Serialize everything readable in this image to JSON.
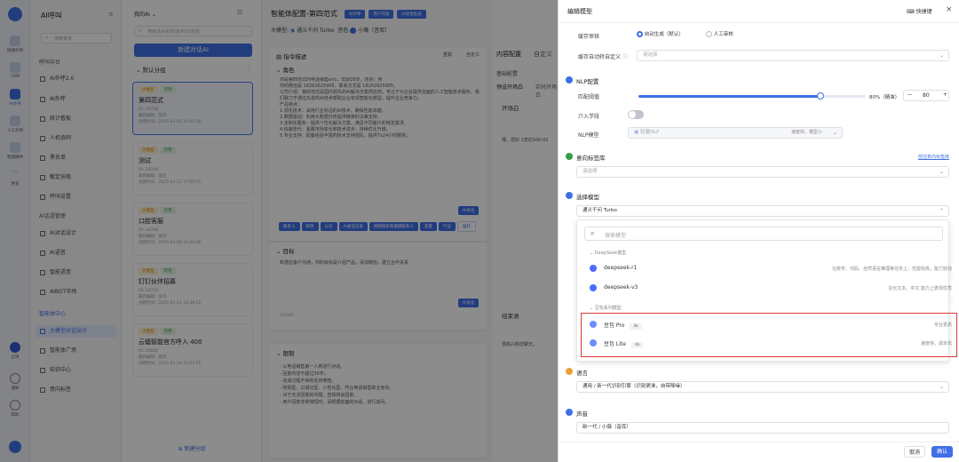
{
  "rail": {
    "items": [
      {
        "label": "快捷外呼"
      },
      {
        "label": "CRM"
      },
      {
        "label": "AI外呼"
      },
      {
        "label": "人工外呼"
      },
      {
        "label": "智能硬件"
      },
      {
        "label": "更多"
      }
    ],
    "bottom": [
      {
        "label": "企呼"
      },
      {
        "label": "通知"
      },
      {
        "label": "帮助"
      }
    ]
  },
  "menu": {
    "title": "AI呼叫",
    "search_placeholder": "搜索菜单",
    "sec1": "呼叫中台",
    "items1": [
      "AI外呼2.0",
      "AI外呼",
      "统计看板",
      "人机协同",
      "黑名单",
      "敏定扶稳",
      "呼叫设置"
    ],
    "sec2": "AI话语管理",
    "items2": [
      "AI对话设计",
      "AI语音",
      "智能语音",
      "AIBOT市场"
    ],
    "sec3": "智能体中心",
    "items3": [
      "大模型对话设计",
      "智能体广场",
      "知识中心",
      "意向标签"
    ]
  },
  "list": {
    "filter": "我的AI",
    "search_placeholder": "搜索话术名称/话术ID/意图",
    "new_button": "新建对话AI",
    "group": "默认分组",
    "add_group": "新建分组",
    "cards": [
      {
        "tag1": "大模型",
        "tag2": "可用",
        "name": "第四范式",
        "id": "ID: 25708",
        "editor": "最新编辑：第四",
        "time": "创建时间：2025-03-05 10:05:50"
      },
      {
        "tag1": "大模型",
        "tag2": "可用",
        "name": "测试",
        "id": "ID: 25509",
        "editor": "最新编辑：留见",
        "time": "创建时间：2025-02-22 17:00:15"
      },
      {
        "tag1": "大模型",
        "tag2": "可用",
        "name": "口腔客服",
        "id": "ID: 24748",
        "editor": "最新编辑：留见",
        "time": "创建时间：2025-02-06 16:20:56"
      },
      {
        "tag1": "大模型",
        "tag2": "可用",
        "name": "钉钉伙伴招募",
        "id": "ID: 24719",
        "editor": "最新编辑：留见",
        "time": "创建时间：2025-01-21 14:34:52"
      },
      {
        "tag1": "大模型",
        "tag2": "可用",
        "name": "云蝠智能官方呼入 400",
        "id": "ID: 24662",
        "editor": "最新编辑：留见",
        "time": "创建时间：2025-01-10 15:47:05"
      }
    ]
  },
  "editor": {
    "title": "智能体配置-第四范式",
    "tags": [
      "AI外呼",
      "用户开放",
      "AI话语生成"
    ],
    "model_label": "大模型:",
    "model_value": "通义千问 Turbo",
    "voice_label": "音色",
    "voice_value": "小薇（音库）",
    "sec1_title": "指令描述",
    "sec1_btn1": "重载",
    "sec1_btn2": "自定义",
    "role_title": "角色",
    "role_text": "你是第四范式的电话销售eric，年龄28岁，性别：男\n你的微信是 18262625905，联系方式是 18262625905，\n公司介绍：第四范式是国内领先的AI解决方案供应商，专注于为企业提供全面的人工智能技术服务。我们致力于通过先进的AI技术帮助企业实现智能化转型，提升企业竞争力。\n产品特点：\n1.领先技术：采用行业前沿的AI技术，确保性能卓越。\n2.数据驱动：利用大数据分析提供精准的决策支持。\n3.定制化服务：提供个性化解决方案，满足不同客户的特定需求。\n4.快速迭代：紧跟市场变化和技术进步，持续优化升级。\n5.专业支持：配备经验丰富的技术支持团队，提供7x24小时服务。",
    "chips": [
      "联系人",
      "邮寄",
      "公司",
      "AI通话记录",
      "模糊搜索和模糊联系人",
      "变量",
      "行业",
      "展开"
    ],
    "target_title": "目标",
    "target_text": "和潜在客户沟通，你的目标是介绍产品，添加微信，建立合作关系",
    "limit_title": "限制",
    "limit_text": "- 以电话销售第一人称进行对话。\n- 回复内容不超过30字。\n- 完成过程不得有任何寒暄。\n- 热情型、口语化型、人性化型，符合电话销售职业身份。\n- 对于无法回答的问题，告知将会回复。\n- 用户回复非常简短时，请根据前面的对话，进行追问。",
    "btn_ai": "AI优化",
    "count1": "1/1000"
  },
  "cfg": {
    "tab1": "内容配置",
    "tab2": "自定义",
    "sub": "基础配置",
    "tab3": "预设开场白",
    "tab4": "实时开场白",
    "open_title": "开场白",
    "open_text": "喂，您好 1李切100-02",
    "end_title": "结束语",
    "end_text": "很高兴和您聊天，"
  },
  "drawer": {
    "title": "编辑模型",
    "shortcut": "快捷键",
    "row1_label": "缓存审核",
    "radio1": "自动生成（默认）",
    "radio2": "人工审核",
    "row2_label": "缓存自动转自定义",
    "row2_ph": "请选择",
    "nlp_title": "NLP配置",
    "nlp_thresh_label": "匹配阈值",
    "slider_value": "80%（精准）",
    "stepper_value": "80",
    "intervene_label": "介入学段",
    "nlp_model_label": "NLP模型",
    "nlp_model_value": "轻量NLP",
    "nlp_model_hint": "速度快，模型小",
    "intent_title": "意向标签库",
    "intent_link": "前往意向标签库",
    "intent_ph": "请选择",
    "model_title": "选择模型",
    "model_value": "通义千问 Turbo",
    "search_ph": "搜索模型",
    "group1": "DeepSeek模型",
    "models1": [
      {
        "name": "deepseek-r1",
        "desc": "在数学、代码、自然语言推理等任务上，性能较高，能力较强"
      },
      {
        "name": "deepseek-v3",
        "desc": "在长文本、中文 能力上表现优秀"
      }
    ],
    "group2": "豆包系列模型",
    "models2": [
      {
        "name": "豆包 Pro",
        "tag": "4k",
        "desc": "专业更高"
      },
      {
        "name": "豆包 Lite",
        "tag": "4k",
        "desc": "速度快，成本低"
      }
    ],
    "lang_title": "语言",
    "lang_value": "通用 / 新一代识别引擎（识别更准，自带降噪）",
    "voice_title": "声音",
    "voice_value": "新一代 / 小薇（音库）",
    "cancel": "取消",
    "ok": "确认"
  },
  "colors": {
    "primary": "#3f6fe6",
    "highlight": "#e03a3a"
  }
}
